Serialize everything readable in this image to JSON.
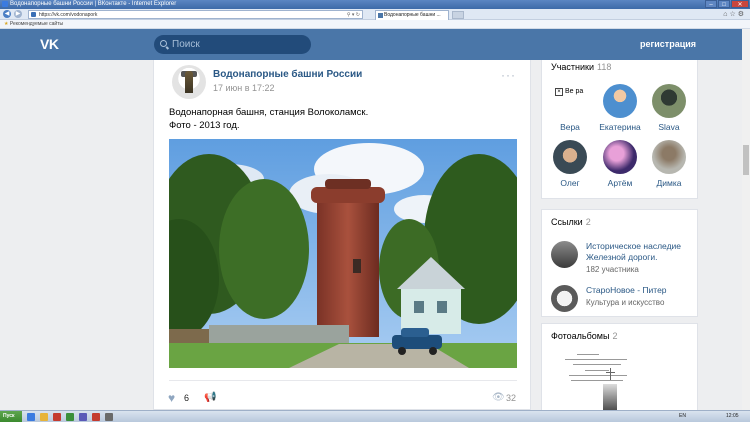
{
  "browser": {
    "window_title": "Водонапорные башни России | ВКонтакте - Internet Explorer",
    "address": "https://vk.com/vodonapork",
    "tab_title": "Водонапорные башни ...",
    "favorites_label": "Рекомендуемые сайты"
  },
  "header": {
    "logo": "VK",
    "search_placeholder": "Поиск",
    "register_label": "регистрация"
  },
  "post": {
    "author": "Водонапорные башни России",
    "date": "17 июн в 17:22",
    "text_line1": "Водонапорная башня, станция Волоколамск.",
    "text_line2": "Фото - 2013 год.",
    "likes": "6",
    "views": "32"
  },
  "members": {
    "title": "Участники",
    "count": "118",
    "broken_alt": "Ве ра",
    "items": [
      {
        "name": "Вера"
      },
      {
        "name": "Екатерина"
      },
      {
        "name": "Slava"
      },
      {
        "name": "Олег"
      },
      {
        "name": "Артём"
      },
      {
        "name": "Димка"
      }
    ]
  },
  "links": {
    "title": "Ссылки",
    "count": "2",
    "items": [
      {
        "title": "Историческое наследие Железной дороги.",
        "subtitle": "182 участника"
      },
      {
        "title": "СтароНовое - Питер",
        "subtitle": "Культура и искусство"
      }
    ]
  },
  "albums": {
    "title": "Фотоальбомы",
    "count": "2"
  },
  "taskbar": {
    "start_label": "Пуск",
    "lang": "EN",
    "time": "12:05"
  },
  "colors": {
    "vk_blue": "#4a76a8",
    "link": "#2a5885",
    "page_bg": "#edeef0"
  }
}
